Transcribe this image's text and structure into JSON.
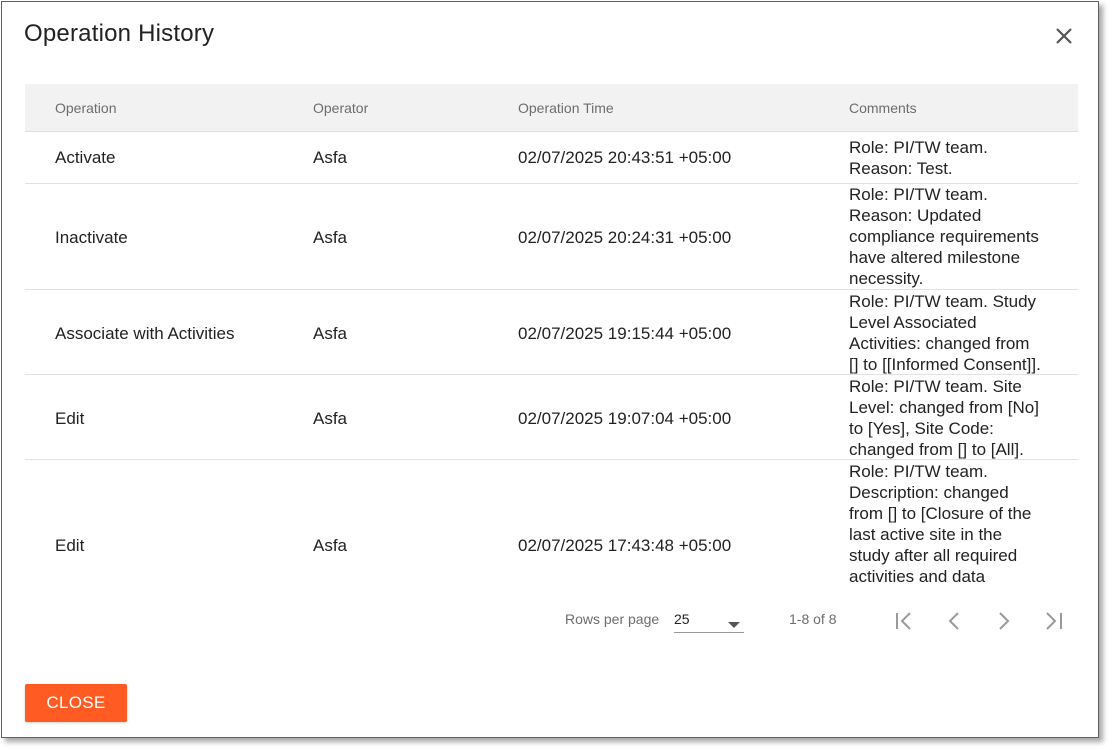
{
  "dialog": {
    "title": "Operation History",
    "close_icon": "close-icon"
  },
  "table": {
    "columns": [
      "Operation",
      "Operator",
      "Operation Time",
      "Comments"
    ],
    "rows": [
      {
        "operation": "Activate",
        "operator": "Asfa",
        "time": "02/07/2025 20:43:51 +05:00",
        "comments": [
          "Role: PI/TW team.",
          "Reason: Test."
        ]
      },
      {
        "operation": "Inactivate",
        "operator": "Asfa",
        "time": "02/07/2025 20:24:31 +05:00",
        "comments": [
          "Role: PI/TW team.",
          "Reason: Updated",
          "compliance requirements",
          "have altered milestone",
          "necessity."
        ]
      },
      {
        "operation": "Associate with Activities",
        "operator": "Asfa",
        "time": "02/07/2025 19:15:44 +05:00",
        "comments": [
          "Role: PI/TW team. Study",
          "Level Associated",
          "Activities: changed from",
          "[] to [[Informed Consent]]."
        ]
      },
      {
        "operation": "Edit",
        "operator": "Asfa",
        "time": "02/07/2025 19:07:04 +05:00",
        "comments": [
          "Role: PI/TW team. Site",
          "Level: changed from [No]",
          "to [Yes], Site Code:",
          "changed from [] to [All]."
        ]
      },
      {
        "operation": "Edit",
        "operator": "Asfa",
        "time": "02/07/2025 17:43:48 +05:00",
        "comments": [
          "Role: PI/TW team.",
          "Description: changed",
          "from [] to [Closure of the",
          "last active site in the",
          "study after all required",
          "activities and data"
        ]
      }
    ]
  },
  "pagination": {
    "rows_per_page_label": "Rows per page",
    "rows_per_page_value": "25",
    "range_label": "1-8 of 8"
  },
  "footer": {
    "close_label": "CLOSE",
    "accent_color": "#ff5b22"
  }
}
